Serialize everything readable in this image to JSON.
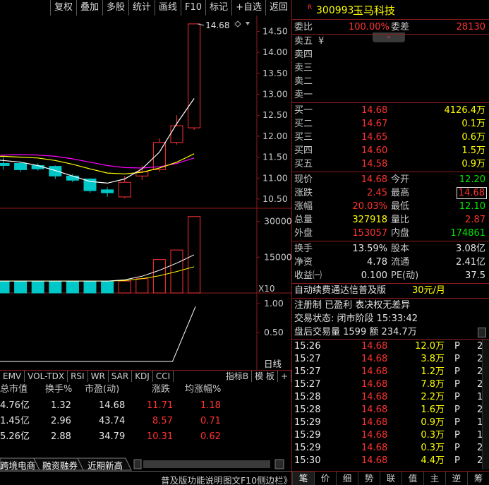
{
  "toolbar": {
    "buttons": [
      "复权",
      "叠加",
      "多股",
      "统计",
      "画线",
      "F10",
      "标记",
      "+自选",
      "返回"
    ]
  },
  "kline": {
    "price_axis": [
      "14.50",
      "14.00",
      "13.50",
      "13.00",
      "12.50",
      "12.00",
      "11.50",
      "11.00",
      "10.50"
    ],
    "high_label": "14.68",
    "candles": [
      {
        "o": 11.35,
        "c": 11.3,
        "h": 11.5,
        "l": 11.2
      },
      {
        "o": 11.35,
        "c": 11.2,
        "h": 11.4,
        "l": 11.15
      },
      {
        "o": 11.3,
        "c": 11.22,
        "h": 11.35,
        "l": 11.18
      },
      {
        "o": 11.28,
        "c": 11.05,
        "h": 11.3,
        "l": 10.98
      },
      {
        "o": 11.05,
        "c": 10.95,
        "h": 11.1,
        "l": 10.9
      },
      {
        "o": 10.98,
        "c": 10.7,
        "h": 11.0,
        "l": 10.65
      },
      {
        "o": 10.72,
        "c": 10.65,
        "h": 10.78,
        "l": 10.55
      },
      {
        "o": 10.55,
        "c": 10.9,
        "h": 11.05,
        "l": 10.52
      },
      {
        "o": 11.05,
        "c": 11.15,
        "h": 11.3,
        "l": 10.95
      },
      {
        "o": 11.2,
        "c": 11.85,
        "h": 11.95,
        "l": 11.15
      },
      {
        "o": 11.85,
        "c": 12.25,
        "h": 12.5,
        "l": 11.8
      },
      {
        "o": 12.2,
        "c": 14.68,
        "h": 14.68,
        "l": 12.15
      }
    ],
    "ma1": [
      11.45,
      11.42,
      11.38,
      11.3,
      11.18,
      11.05,
      10.92,
      10.88,
      10.98,
      11.22,
      11.62,
      12.3,
      12.9
    ],
    "ma2": [
      11.5,
      11.52,
      11.5,
      11.48,
      11.42,
      11.33,
      11.22,
      11.12,
      11.1,
      11.14,
      11.24,
      11.38,
      11.58
    ],
    "ma3": [
      11.5,
      11.55,
      11.56,
      11.55,
      11.52,
      11.46,
      11.38,
      11.3,
      11.25,
      11.24,
      11.27,
      11.35,
      11.48
    ]
  },
  "volume": {
    "axis": [
      "30000",
      "15000"
    ],
    "unit_label": "X10",
    "bars": [
      5,
      5,
      5,
      5,
      5,
      5,
      5,
      5,
      6,
      14,
      18,
      32
    ]
  },
  "indicator": {
    "axis": [
      "1.00",
      "0.50",
      "0.00"
    ],
    "label": "日线"
  },
  "indbar": {
    "tabs": [
      "EMV",
      "VOL-TDX",
      "RSI",
      "WR",
      "SAR",
      "KDJ",
      "CCI"
    ],
    "right_tabs": [
      "指标B",
      "模 板",
      "+"
    ]
  },
  "table": {
    "headers": [
      "总市值",
      "换手%",
      "市盈(动)",
      "涨跌",
      "均涨幅%"
    ],
    "rows": [
      [
        "4.76亿",
        "1.32",
        "14.68",
        "11.71",
        "1.18"
      ],
      [
        "1.45亿",
        "2.96",
        "43.74",
        "8.57",
        "0.71"
      ],
      [
        "5.26亿",
        "2.88",
        "34.79",
        "10.31",
        "0.62"
      ]
    ]
  },
  "sheet_tabs": [
    "跨境电商",
    "融资融券",
    "近期新高"
  ],
  "statusbar": [
    "普及版功能说明",
    "图文F10",
    "侧边栏》"
  ],
  "quote": {
    "flag": "R",
    "code": "300993",
    "name": "玉马科技",
    "webi_label": "委比",
    "webi": "100.00%",
    "wecha_label": "委差",
    "wecha": "28130",
    "sell": [
      {
        "label": "卖五",
        "extra": "¥"
      },
      {
        "label": "卖四",
        "extra": ""
      },
      {
        "label": "卖三",
        "extra": ""
      },
      {
        "label": "卖二",
        "extra": ""
      },
      {
        "label": "卖一",
        "extra": ""
      }
    ],
    "buy": [
      {
        "label": "买一",
        "price": "14.68",
        "vol": "4126.4万"
      },
      {
        "label": "买二",
        "price": "14.67",
        "vol": "0.1万"
      },
      {
        "label": "买三",
        "price": "14.65",
        "vol": "0.6万"
      },
      {
        "label": "买四",
        "price": "14.60",
        "vol": "1.5万"
      },
      {
        "label": "买五",
        "price": "14.58",
        "vol": "0.9万"
      }
    ],
    "stats": [
      {
        "l1": "现价",
        "v1": "14.68",
        "l2": "今开",
        "v2": "12.20"
      },
      {
        "l1": "涨跌",
        "v1": "2.45",
        "l2": "最高",
        "v2": "14.68"
      },
      {
        "l1": "涨幅",
        "v1": "20.03%",
        "l2": "最低",
        "v2": "12.10"
      },
      {
        "l1": "总量",
        "v1": "327918",
        "l2": "量比",
        "v2": "2.87"
      },
      {
        "l1": "外盘",
        "v1": "153057",
        "l2": "内盘",
        "v2": "174861"
      }
    ],
    "fund": [
      {
        "l1": "换手",
        "v1": "13.59%",
        "l2": "股本",
        "v2": "3.08亿"
      },
      {
        "l1": "净资",
        "v1": "4.78",
        "l2": "流通",
        "v2": "2.41亿"
      },
      {
        "l1": "收益㈠",
        "v1": "0.100",
        "l2": "PE(动)",
        "v2": "37.5"
      }
    ],
    "promo1": "自动续费通达信普及版",
    "promo1_price": "30元/月",
    "promo2": "注册制 已盈利 表决权无差异",
    "trade_status": "交易状态: 闭市阶段 15:33:42",
    "after_hours": "盘后交易量 1599 额 234.7万",
    "ticks": [
      [
        "15:26",
        "14.68",
        "12.0万",
        "P",
        "2"
      ],
      [
        "15:27",
        "14.68",
        "3.8万",
        "P",
        "2"
      ],
      [
        "15:27",
        "14.68",
        "1.2万",
        "P",
        "2"
      ],
      [
        "15:27",
        "14.68",
        "7.8万",
        "P",
        "2"
      ],
      [
        "15:28",
        "14.68",
        "2.2万",
        "P",
        "1"
      ],
      [
        "15:28",
        "14.68",
        "1.6万",
        "P",
        "2"
      ],
      [
        "15:29",
        "14.68",
        "0.9万",
        "P",
        "1"
      ],
      [
        "15:29",
        "14.68",
        "0.3万",
        "P",
        "1"
      ],
      [
        "15:29",
        "14.68",
        "0.3万",
        "P",
        "2"
      ],
      [
        "15:30",
        "14.68",
        "4.4万",
        "P",
        "2"
      ]
    ],
    "bottom_tabs": [
      "笔",
      "价",
      "细",
      "势",
      "联",
      "值",
      "主",
      "逆",
      "筹"
    ]
  },
  "colors": {
    "up": "#ff3232",
    "down_fill": "#00c8c8",
    "ma1": "#ffffff",
    "ma2": "#ffff00",
    "ma3": "#ff00ff",
    "grid": "#8c1c1c"
  }
}
